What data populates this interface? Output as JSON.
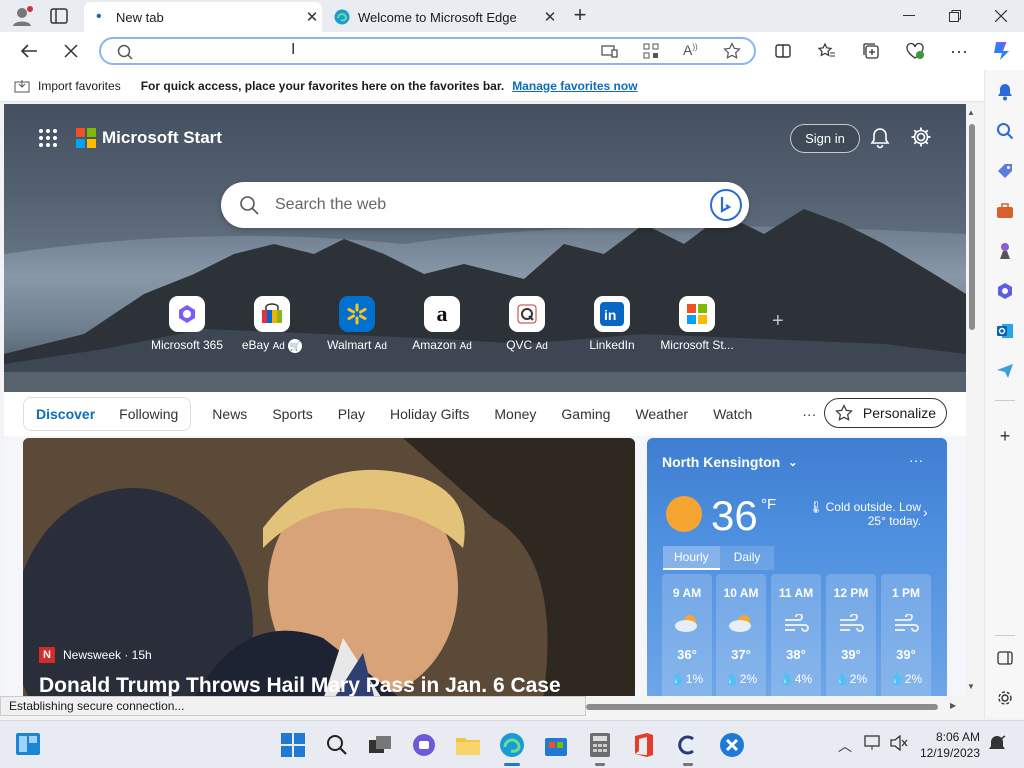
{
  "tabs": [
    {
      "title": "New tab"
    },
    {
      "title": "Welcome to Microsoft Edge"
    }
  ],
  "favorites_bar": {
    "import_label": "Import favorites",
    "message": "For quick access, place your favorites here on the favorites bar.",
    "manage_link": "Manage favorites now"
  },
  "header": {
    "brand": "Microsoft Start",
    "sign_in": "Sign in"
  },
  "search": {
    "placeholder": "Search the web"
  },
  "quick_links": [
    {
      "label": "Microsoft 365"
    },
    {
      "label": "eBay",
      "ad": "Ad"
    },
    {
      "label": "Walmart",
      "ad": "Ad"
    },
    {
      "label": "Amazon",
      "ad": "Ad"
    },
    {
      "label": "QVC",
      "ad": "Ad"
    },
    {
      "label": "LinkedIn"
    },
    {
      "label": "Microsoft St..."
    }
  ],
  "nav": {
    "discover": "Discover",
    "following": "Following",
    "items": [
      "News",
      "Sports",
      "Play",
      "Holiday Gifts",
      "Money",
      "Gaming",
      "Weather",
      "Watch"
    ],
    "more": "···",
    "personalize": "Personalize"
  },
  "news": {
    "source": "Newsweek · 15h",
    "headline": "Donald Trump Throws Hail Mary Pass in Jan. 6 Case"
  },
  "weather": {
    "location": "North Kensington",
    "temp": "36",
    "unit": "°F",
    "note": "Cold outside. Low 25° today.",
    "tabs": [
      "Hourly",
      "Daily"
    ],
    "hourly": [
      {
        "time": "9 AM",
        "temp": "36°",
        "precip": "1%"
      },
      {
        "time": "10 AM",
        "temp": "37°",
        "precip": "2%"
      },
      {
        "time": "11 AM",
        "temp": "38°",
        "precip": "4%"
      },
      {
        "time": "12 PM",
        "temp": "39°",
        "precip": "2%"
      },
      {
        "time": "1 PM",
        "temp": "39°",
        "precip": "2%"
      }
    ]
  },
  "status": "Establishing secure connection...",
  "clock": {
    "time": "8:06 AM",
    "date": "12/19/2023"
  },
  "colors": {
    "accent": "#0f6cbd",
    "link": "#0f6cbd"
  }
}
